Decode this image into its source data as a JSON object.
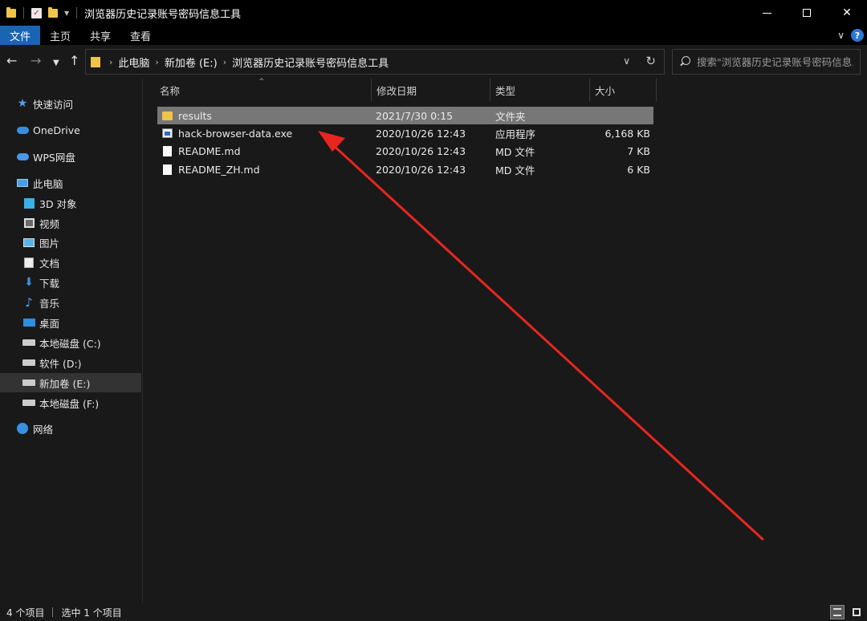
{
  "window": {
    "title": "浏览器历史记录账号密码信息工具",
    "minimize": "—",
    "close": "✕"
  },
  "ribbon": {
    "tabs": [
      "文件",
      "主页",
      "共享",
      "查看"
    ],
    "help": "?"
  },
  "address": {
    "crumbs": [
      "此电脑",
      "新加卷 (E:)",
      "浏览器历史记录账号密码信息工具"
    ]
  },
  "search": {
    "placeholder": "搜索\"浏览器历史记录账号密码信息..."
  },
  "sidebar": {
    "items": [
      {
        "label": "快速访问",
        "icon": "star-icon"
      },
      {
        "label": "OneDrive",
        "icon": "cloud-icon"
      },
      {
        "label": "WPS网盘",
        "icon": "cloud-icon"
      },
      {
        "label": "此电脑",
        "icon": "computer-icon"
      },
      {
        "label": "3D 对象",
        "icon": "cube-icon"
      },
      {
        "label": "视频",
        "icon": "video-icon"
      },
      {
        "label": "图片",
        "icon": "picture-icon"
      },
      {
        "label": "文档",
        "icon": "document-icon"
      },
      {
        "label": "下载",
        "icon": "download-icon"
      },
      {
        "label": "音乐",
        "icon": "music-icon"
      },
      {
        "label": "桌面",
        "icon": "desktop-icon"
      },
      {
        "label": "本地磁盘 (C:)",
        "icon": "drive-icon"
      },
      {
        "label": "软件 (D:)",
        "icon": "drive-icon"
      },
      {
        "label": "新加卷 (E:)",
        "icon": "drive-icon"
      },
      {
        "label": "本地磁盘 (F:)",
        "icon": "drive-icon"
      },
      {
        "label": "网络",
        "icon": "network-icon"
      }
    ]
  },
  "columns": {
    "name": "名称",
    "date": "修改日期",
    "type": "类型",
    "size": "大小"
  },
  "files": [
    {
      "name": "results",
      "date": "2021/7/30 0:15",
      "type": "文件夹",
      "size": "",
      "icon": "folder-icon"
    },
    {
      "name": "hack-browser-data.exe",
      "date": "2020/10/26 12:43",
      "type": "应用程序",
      "size": "6,168 KB",
      "icon": "exe-icon"
    },
    {
      "name": "README.md",
      "date": "2020/10/26 12:43",
      "type": "MD 文件",
      "size": "7 KB",
      "icon": "file-icon"
    },
    {
      "name": "README_ZH.md",
      "date": "2020/10/26 12:43",
      "type": "MD 文件",
      "size": "6 KB",
      "icon": "file-icon"
    }
  ],
  "status": {
    "count": "4 个项目",
    "selected": "选中 1 个项目"
  },
  "colors": {
    "accent": "#1a64b4",
    "annotation_arrow": "#e8261f"
  }
}
